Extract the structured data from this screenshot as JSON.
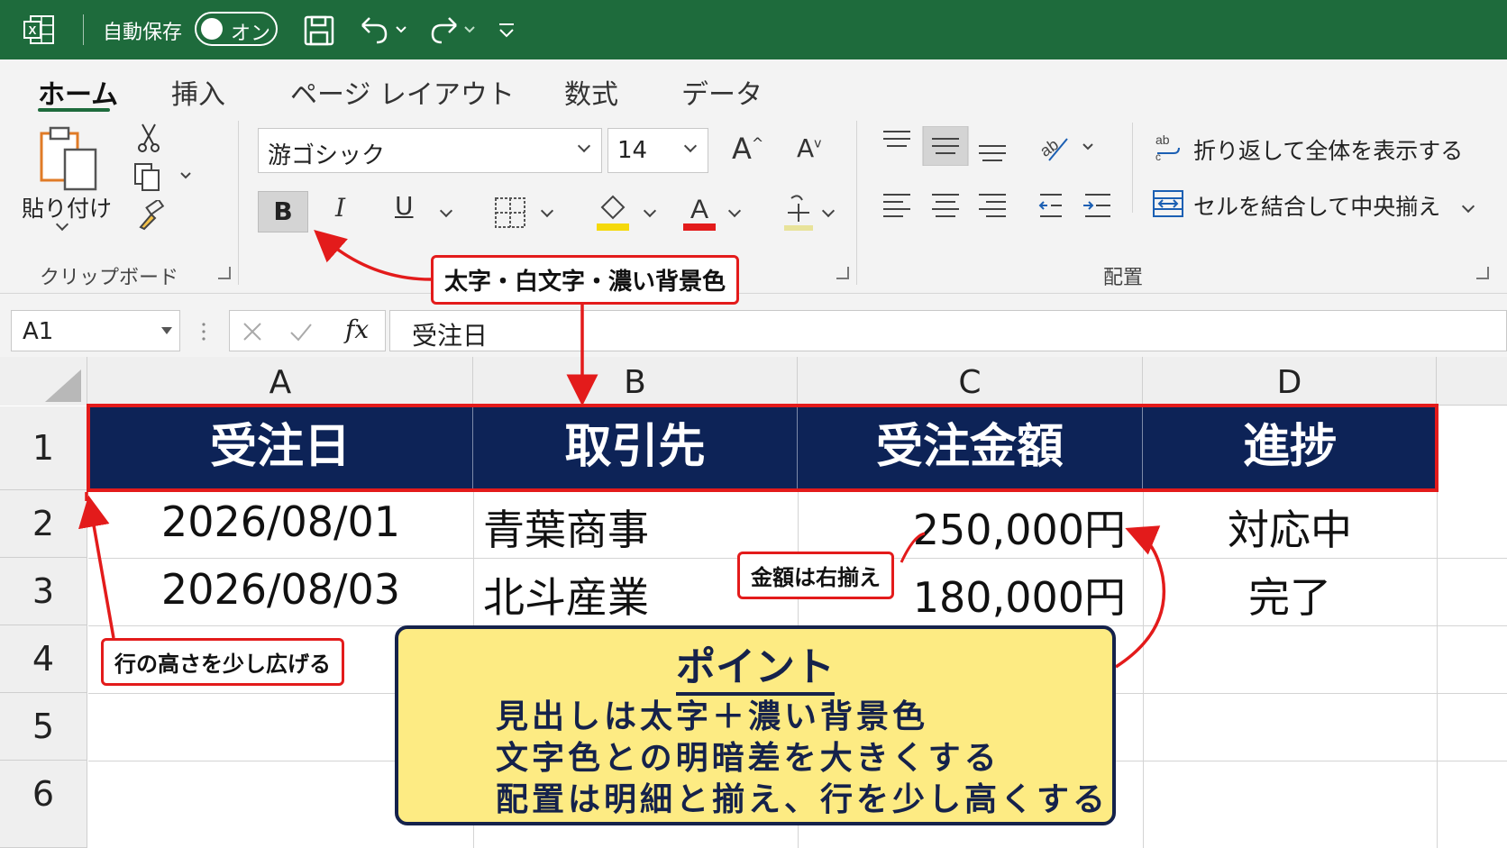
{
  "titlebar": {
    "autosave_label": "自動保存",
    "toggle_label": "オン"
  },
  "tabs": [
    {
      "label": "ホーム"
    },
    {
      "label": "挿入"
    },
    {
      "label": "ページ レイアウト"
    },
    {
      "label": "数式"
    },
    {
      "label": "データ"
    }
  ],
  "ribbon": {
    "clipboard": {
      "paste_label": "貼り付け",
      "group_label": "クリップボード"
    },
    "font": {
      "name": "游ゴシック",
      "size": "14",
      "bold": "B",
      "italic": "I",
      "underline": "U"
    },
    "alignment": {
      "wrap_label": "折り返して全体を表示する",
      "merge_label": "セルを結合して中央揃え",
      "group_label": "配置"
    }
  },
  "formula_bar": {
    "name_box": "A1",
    "fx": "fx",
    "content": "受注日"
  },
  "columns": [
    "A",
    "B",
    "C",
    "D"
  ],
  "rows": [
    "1",
    "2",
    "3",
    "4",
    "5",
    "6"
  ],
  "header": [
    "受注日",
    "取引先",
    "受注金額",
    "進捗"
  ],
  "data_rows": [
    [
      "2026/08/01",
      "青葉商事",
      "250,000円",
      "対応中"
    ],
    [
      "2026/08/03",
      "北斗産業",
      "180,000円",
      "完了"
    ]
  ],
  "annotations": {
    "header_style": "太字・白文字・濃い背景色",
    "amount_align": "金額は右揃え",
    "row_height": "行の高さを少し広げる"
  },
  "point": {
    "title": "ポイント",
    "lines": [
      "見出しは太字＋濃い背景色",
      "文字色との明暗差を大きくする",
      "配置は明細と揃え、行を少し高くする"
    ]
  },
  "colors": {
    "brand": "#1e6b3c",
    "header_bg": "#0d2357",
    "accent": "#e31b1b",
    "note_bg": "#fdeb83"
  }
}
